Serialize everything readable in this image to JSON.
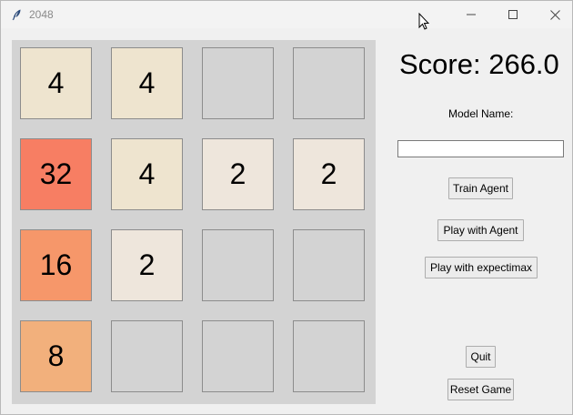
{
  "window": {
    "title": "2048",
    "icon": "feather-icon"
  },
  "board": {
    "empty_color": "#d3d3d3",
    "tiles": [
      [
        {
          "value": "4",
          "color": "#eee4cf"
        },
        {
          "value": "4",
          "color": "#eee4cf"
        },
        {
          "value": "",
          "color": "#d3d3d3"
        },
        {
          "value": "",
          "color": "#d3d3d3"
        }
      ],
      [
        {
          "value": "32",
          "color": "#f77e63"
        },
        {
          "value": "4",
          "color": "#eee4cf"
        },
        {
          "value": "2",
          "color": "#eee6dc"
        },
        {
          "value": "2",
          "color": "#eee6dc"
        }
      ],
      [
        {
          "value": "16",
          "color": "#f6976a"
        },
        {
          "value": "2",
          "color": "#eee6dc"
        },
        {
          "value": "",
          "color": "#d3d3d3"
        },
        {
          "value": "",
          "color": "#d3d3d3"
        }
      ],
      [
        {
          "value": "8",
          "color": "#f2b07c"
        },
        {
          "value": "",
          "color": "#d3d3d3"
        },
        {
          "value": "",
          "color": "#d3d3d3"
        },
        {
          "value": "",
          "color": "#d3d3d3"
        }
      ]
    ]
  },
  "panel": {
    "score_text": "Score: 266.0",
    "model_label": "Model Name:",
    "model_value": "",
    "buttons": {
      "train": "Train Agent",
      "play_agent": "Play with Agent",
      "play_expectimax": "Play with expectimax",
      "quit": "Quit",
      "reset": "Reset Game"
    }
  }
}
